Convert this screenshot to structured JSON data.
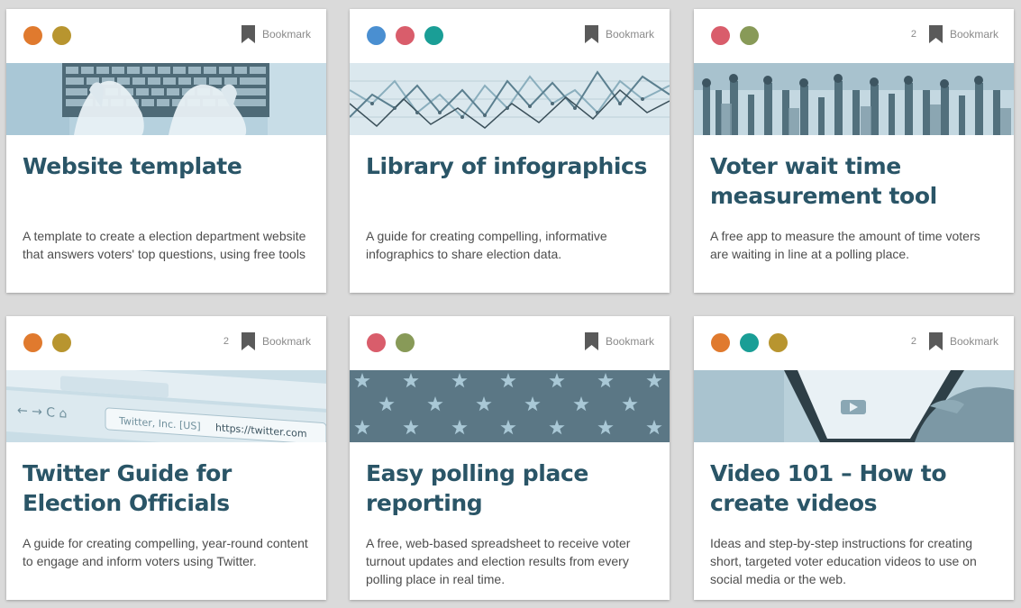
{
  "bookmark_label": "Bookmark",
  "cards": [
    {
      "title": "Website template",
      "description": "A template to create a election department website that answers voters' top questions, using free tools",
      "bookmark_count": "",
      "dots": [
        "#e07a2e",
        "#b8952f"
      ],
      "banner": "keyboard"
    },
    {
      "title": "Library of infographics",
      "description": "A guide for creating compelling, informative infographics to share election data.",
      "bookmark_count": "",
      "dots": [
        "#4a8fd1",
        "#d95d6b",
        "#1a9e96"
      ],
      "banner": "linegraph"
    },
    {
      "title": "Voter wait time\nmeasurement tool",
      "description": "A free app to measure the amount of time voters are waiting in line at a polling place.",
      "bookmark_count": "2",
      "dots": [
        "#d95d6b",
        "#889a58"
      ],
      "banner": "crowd"
    },
    {
      "title": "Twitter Guide for\nElection Officials",
      "description": "A guide for creating compelling, year-round content to engage and inform voters using Twitter.",
      "bookmark_count": "2",
      "dots": [
        "#e07a2e",
        "#b8952f"
      ],
      "banner": "browser",
      "browser_address_site": "Twitter, Inc. [US]",
      "browser_address_url": "https://twitter.com"
    },
    {
      "title": "Easy polling place\nreporting",
      "description": "A free, web-based spreadsheet to receive voter turnout updates and election results from every polling place in real time.",
      "bookmark_count": "",
      "dots": [
        "#d95d6b",
        "#889a58"
      ],
      "banner": "stars"
    },
    {
      "title": "Video 101 – How to\ncreate videos",
      "description": "Ideas and step-by-step instructions for creating short, targeted voter education videos to use on social media or the web.",
      "bookmark_count": "2",
      "dots": [
        "#e07a2e",
        "#1a9e96",
        "#b8952f"
      ],
      "banner": "phone"
    }
  ]
}
